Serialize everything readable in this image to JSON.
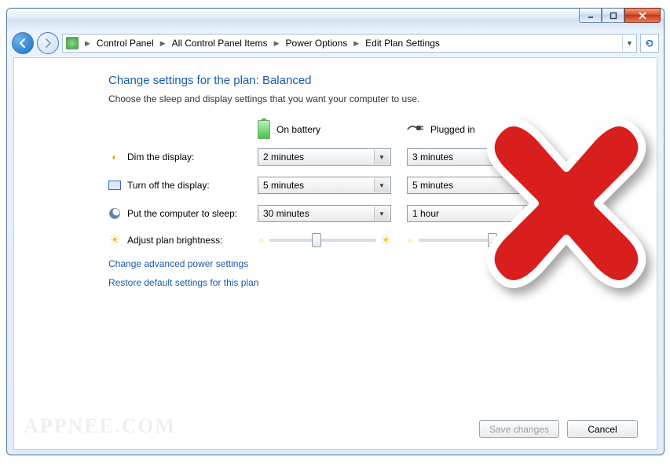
{
  "breadcrumb": {
    "items": [
      "Control Panel",
      "All Control Panel Items",
      "Power Options",
      "Edit Plan Settings"
    ]
  },
  "heading": "Change settings for the plan: Balanced",
  "subtext": "Choose the sleep and display settings that you want your computer to use.",
  "columns": {
    "battery": "On battery",
    "plugged": "Plugged in"
  },
  "rows": {
    "dim": {
      "label": "Dim the display:",
      "battery": "2 minutes",
      "plugged": "3 minutes"
    },
    "off": {
      "label": "Turn off the display:",
      "battery": "5 minutes",
      "plugged": "5 minutes"
    },
    "sleep": {
      "label": "Put the computer to sleep:",
      "battery": "30 minutes",
      "plugged": "1 hour"
    },
    "bright": {
      "label": "Adjust plan brightness:",
      "battery_pct": 40,
      "plugged_pct": 65
    }
  },
  "links": {
    "advanced": "Change advanced power settings",
    "restore": "Restore default settings for this plan"
  },
  "buttons": {
    "save": "Save changes",
    "cancel": "Cancel"
  },
  "watermark": "APPNEE.COM"
}
